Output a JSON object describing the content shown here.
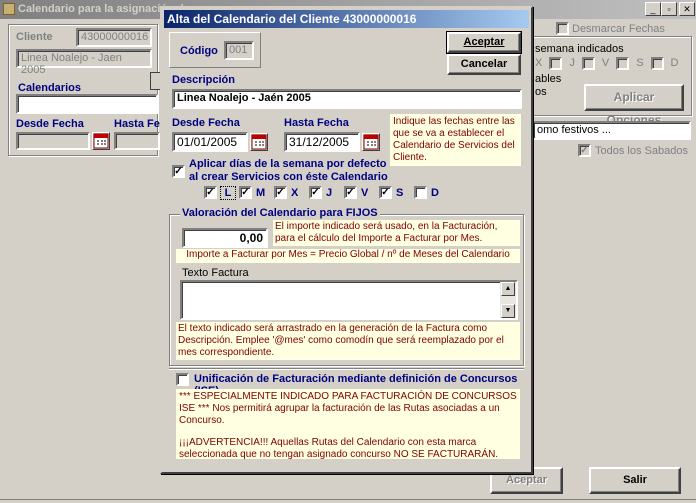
{
  "background_window": {
    "title": "Calendario para la asignación de ...",
    "client_label": "Cliente",
    "client_code": "43000000016",
    "client_name": "Linea Noalejo - Jaen 2005",
    "calendars_label": "Calendarios",
    "from_date_label": "Desde Fecha",
    "to_date_label": "Hasta Fecha",
    "uncheck_dates_label": "Desmarcar Fechas",
    "weekdays_indicated_label": "semana indicados",
    "weekdays": [
      "X",
      "J",
      "V",
      "S",
      "D"
    ],
    "text_ables": "ables",
    "text_os": "os",
    "apply_options_button": "Aplicar Opciones",
    "holidays_field": "omo festivos ...",
    "all_saturdays_label": "Todos los Sabados",
    "accept_button": "Aceptar",
    "exit_button": "Salir"
  },
  "dialog": {
    "title": "Alta del Calendario del Cliente 43000000016",
    "code_label": "Código",
    "code_value": "001",
    "accept_button": "Aceptar",
    "cancel_button": "Cancelar",
    "description_label": "Descripción",
    "description_value": "Linea Noalejo - Jaén 2005",
    "from_date_label": "Desde Fecha",
    "from_date_value": "01/01/2005",
    "to_date_label": "Hasta Fecha",
    "to_date_value": "31/12/2005",
    "dates_note": "Indique las fechas entre las que se va a establecer el Calendario de Servicios del Cliente.",
    "apply_weekdays_label": "Aplicar días de la semana por defecto al crear Servicios con éste Calendario",
    "weekdays": [
      {
        "label": "L",
        "checked": true
      },
      {
        "label": "M",
        "checked": true
      },
      {
        "label": "X",
        "checked": true
      },
      {
        "label": "J",
        "checked": true
      },
      {
        "label": "V",
        "checked": true
      },
      {
        "label": "S",
        "checked": true
      },
      {
        "label": "D",
        "checked": false
      }
    ],
    "valuation_title": "Valoración del Calendario para FIJOS",
    "amount_value": "0,00",
    "amount_note": "El importe indicado será usado, en la Facturación, para el cálculo del Importe a Facturar por Mes.",
    "formula_note": "Importe a Facturar por Mes = Precio Global / nº de Meses del Calendario",
    "invoice_text_label": "Texto Factura",
    "invoice_text_value": "",
    "invoice_note": "El texto indicado será arrastrado en la generación de la Factura como Descripción. Emplee '@mes' como comodín que será reemplazado por el mes correspondiente.",
    "unify_label": "Unificación de Facturación mediante definición de Concursos (ISE)",
    "unify_checked": false,
    "ise_note_1": "*** ESPECIALMENTE  INDICADO PARA FACTURACIÓN DE CONCURSOS ISE *** Nos permitirá agrupar la facturación de las Rutas asociadas a un Concurso.",
    "ise_note_2": "¡¡¡ADVERTENCIA!!! Aquellas Rutas del Calendario con esta marca seleccionada que no tengan asignado concurso NO SE FACTURARÁN."
  },
  "icons": {
    "minimize": "minimize-icon",
    "restore": "restore-icon",
    "close": "close-icon",
    "calendar": "calendar-icon"
  }
}
